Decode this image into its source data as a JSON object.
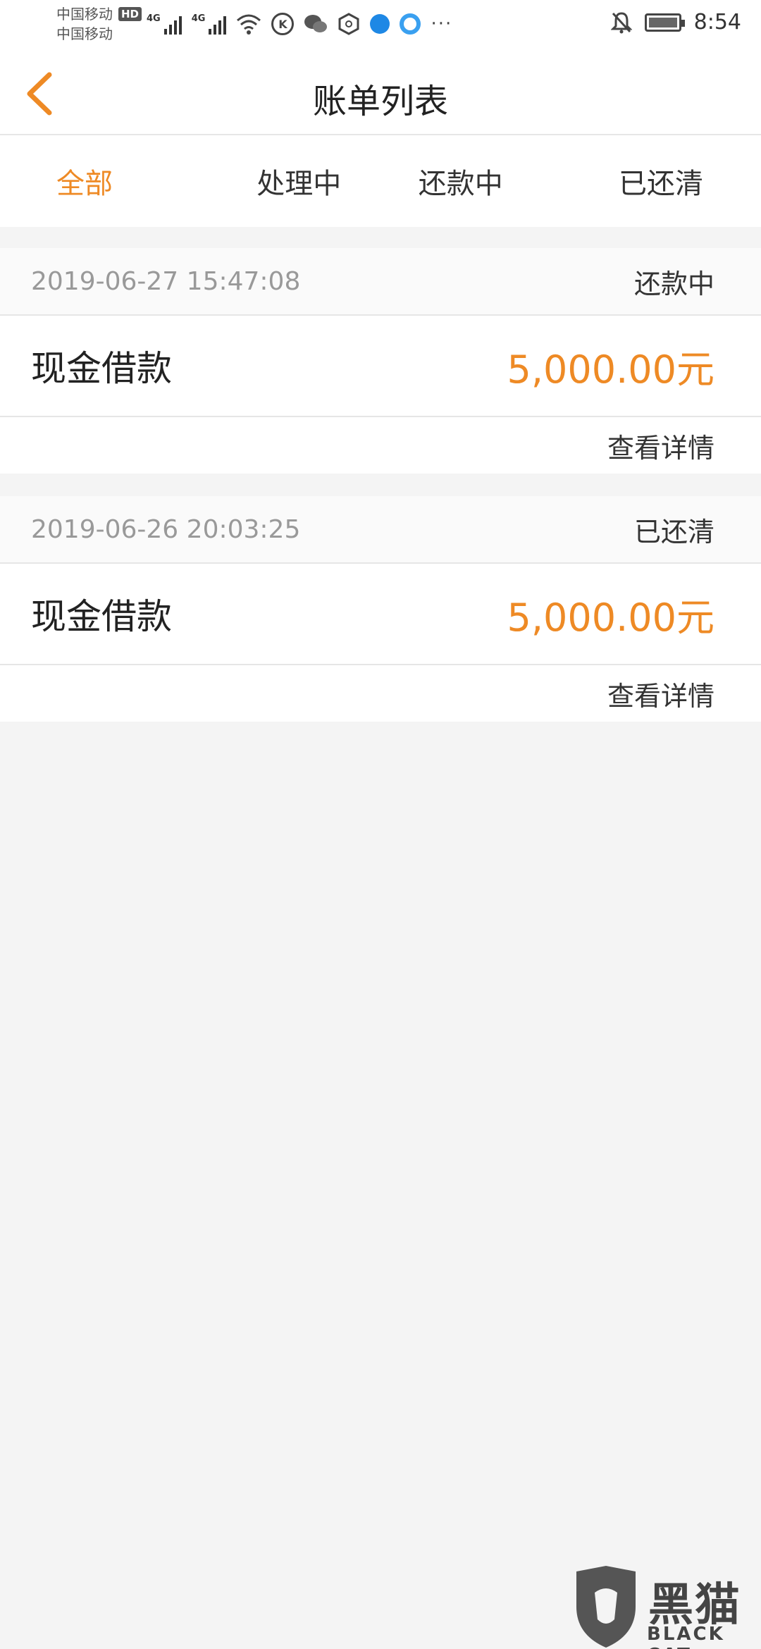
{
  "status_bar": {
    "carrier1": "中国移动",
    "carrier2": "中国移动",
    "hd": "HD",
    "net1": "4G",
    "net2": "4G",
    "k_icon": "K",
    "more": "···",
    "time": "8:54",
    "icons": [
      "signal-icon",
      "wifi-icon",
      "k-app-icon",
      "wechat-icon",
      "hexagon-app-icon",
      "browser-icon",
      "qq-browser-icon",
      "mute-bell-icon",
      "battery-charging-icon"
    ]
  },
  "navbar": {
    "title": "账单列表",
    "back_icon": "chevron-left-icon"
  },
  "tabs": [
    {
      "label": "全部",
      "active": true
    },
    {
      "label": "处理中",
      "active": false
    },
    {
      "label": "还款中",
      "active": false
    },
    {
      "label": "已还清",
      "active": false
    }
  ],
  "bills": [
    {
      "date": "2019-06-27 15:47:08",
      "status": "还款中",
      "type": "现金借款",
      "amount": "5,000.00元",
      "detail_label": "查看详情"
    },
    {
      "date": "2019-06-26 20:03:25",
      "status": "已还清",
      "type": "现金借款",
      "amount": "5,000.00元",
      "detail_label": "查看详情"
    }
  ],
  "watermark": {
    "cn": "黑猫",
    "en": "BLACK CAT"
  },
  "colors": {
    "accent": "#ee8a25",
    "background": "#f4f4f4"
  }
}
